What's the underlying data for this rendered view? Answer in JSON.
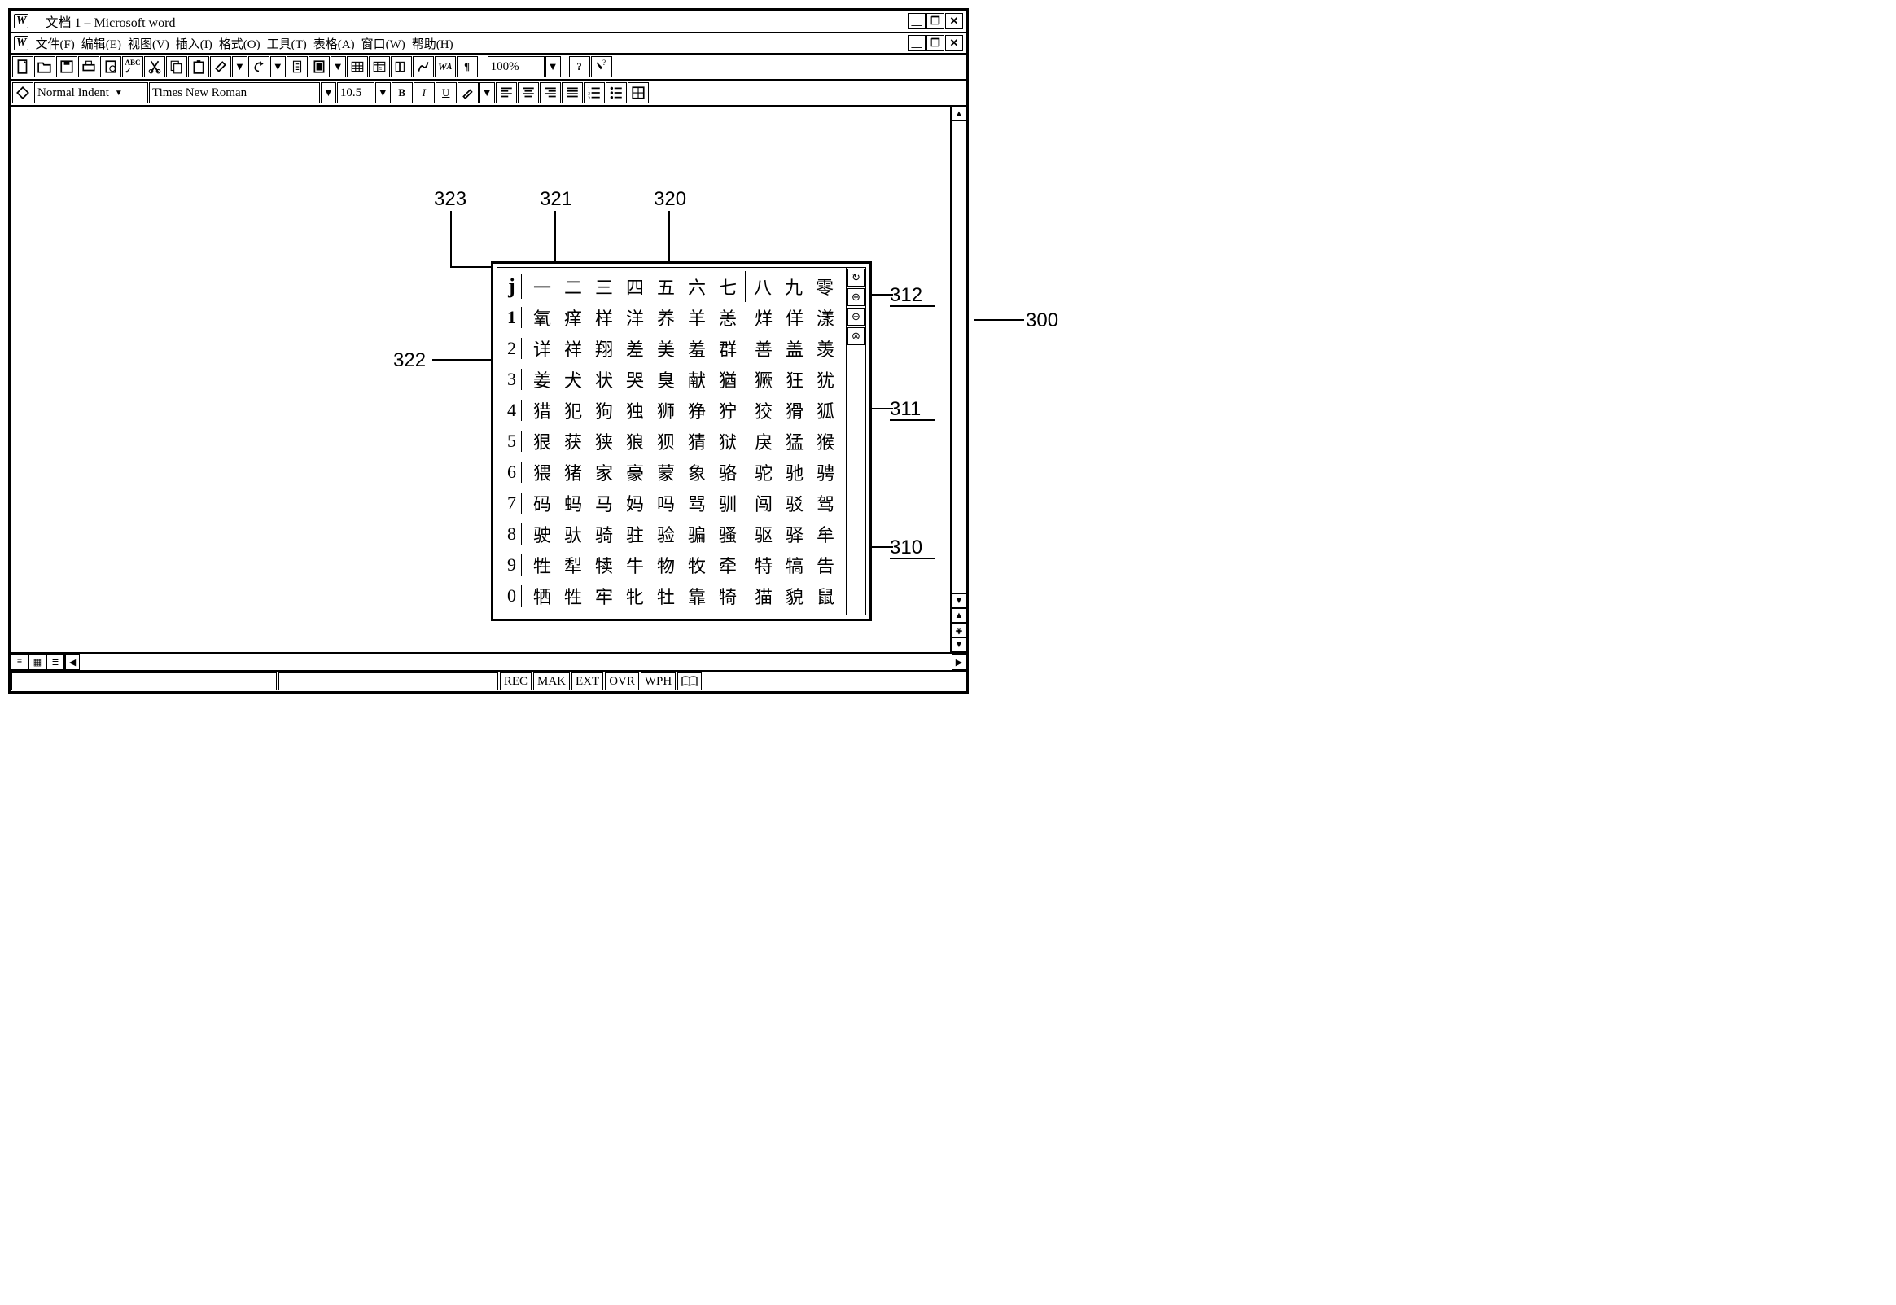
{
  "title": "文档 1 – Microsoft word",
  "menus": [
    "文件(F)",
    "编辑(E)",
    "视图(V)",
    "插入(I)",
    "格式(O)",
    "工具(T)",
    "表格(A)",
    "窗口(W)",
    "帮助(H)"
  ],
  "zoom": "100%",
  "style": "Normal Indent",
  "font": "Times New Roman",
  "fontsize": "10.5",
  "bold": "B",
  "italic": "I",
  "underline": "U",
  "status": [
    "REC",
    "MAK",
    "EXT",
    "OVR",
    "WPH"
  ],
  "ime": {
    "input": "j",
    "header": [
      "一",
      "二",
      "三",
      "四",
      "五",
      "六",
      "七",
      "八",
      "九",
      "零"
    ],
    "rows": [
      {
        "idx": "1",
        "cells": [
          "氧",
          "痒",
          "样",
          "洋",
          "养",
          "羊",
          "恙",
          "烊",
          "佯",
          "漾"
        ]
      },
      {
        "idx": "2",
        "cells": [
          "详",
          "祥",
          "翔",
          "差",
          "美",
          "羞",
          "群",
          "善",
          "盖",
          "羡"
        ]
      },
      {
        "idx": "3",
        "cells": [
          "姜",
          "犬",
          "状",
          "哭",
          "臭",
          "献",
          "猶",
          "獗",
          "狂",
          "犹"
        ]
      },
      {
        "idx": "4",
        "cells": [
          "猎",
          "犯",
          "狗",
          "独",
          "狮",
          "狰",
          "狞",
          "狡",
          "猾",
          "狐"
        ]
      },
      {
        "idx": "5",
        "cells": [
          "狠",
          "获",
          "狭",
          "狼",
          "狈",
          "猜",
          "狱",
          "戾",
          "猛",
          "猴"
        ]
      },
      {
        "idx": "6",
        "cells": [
          "猥",
          "猪",
          "家",
          "豪",
          "蒙",
          "象",
          "骆",
          "驼",
          "驰",
          "骋"
        ]
      },
      {
        "idx": "7",
        "cells": [
          "码",
          "蚂",
          "马",
          "妈",
          "吗",
          "骂",
          "驯",
          "闯",
          "驳",
          "驾"
        ]
      },
      {
        "idx": "8",
        "cells": [
          "驶",
          "驮",
          "骑",
          "驻",
          "验",
          "骗",
          "骚",
          "驱",
          "驿",
          "牟"
        ]
      },
      {
        "idx": "9",
        "cells": [
          "牲",
          "犁",
          "犊",
          "牛",
          "物",
          "牧",
          "牵",
          "特",
          "犒",
          "告"
        ]
      },
      {
        "idx": "0",
        "cells": [
          "牺",
          "牲",
          "牢",
          "牝",
          "牡",
          "靠",
          "犄",
          "猫",
          "貌",
          "鼠"
        ]
      }
    ]
  },
  "callouts": {
    "c323": "323",
    "c321": "321",
    "c320": "320",
    "c322": "322",
    "c312": "312",
    "c311": "311",
    "c310": "310",
    "c300": "300"
  }
}
